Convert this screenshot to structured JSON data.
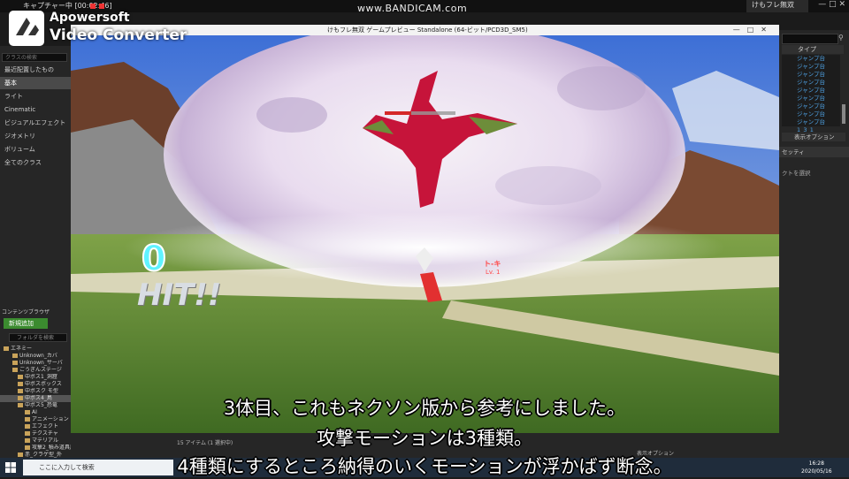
{
  "recorder": {
    "capture_label": "キャプチャー中 [00:02:46]",
    "bandicam": "www.BANDICAM.com"
  },
  "watermark": {
    "line1": "Apowersoft",
    "line2": "Video Converter"
  },
  "editor_tab": "けもフレ無双",
  "game_window": {
    "title": "けもフレ無双 ゲームプレビュー Standalone (64-ビット/PCD3D_SM5)"
  },
  "place_panel": {
    "search_placeholder": "クラスの検索",
    "items": [
      "最近配置したもの",
      "基本",
      "ライト",
      "Cinematic",
      "ビジュアルエフェクト",
      "ジオメトリ",
      "ボリューム",
      "全てのクラス"
    ]
  },
  "content_browser": {
    "header": "コンテンツブラウザ",
    "add_new": "新規追加",
    "search_placeholder": "フォルダを検索",
    "tree": [
      "エネミー",
      "Unknown_カバ",
      "Unknown_サーバ",
      "ごうぎんステージ",
      "中ボス1_洞窟",
      "中ボスボックス",
      "中ボスク モ型",
      "中ボス4_鳥",
      "中ボス5_恐竜",
      "AI",
      "アニメーション",
      "エフェクト",
      "テクスチャ",
      "マテリアル",
      "攻撃2_積み道具用",
      "赤_クラゲ型_外"
    ],
    "selected_index": 7,
    "item_count": "15 アイテム (1 選択中)"
  },
  "outliner": {
    "column_type": "タイプ",
    "items": [
      "ジャンプ台1_3_1",
      "ジャンプ台1_3_1",
      "ジャンプ台1_3_1",
      "ジャンプ台1_3_1",
      "ジャンプ台1_3_1",
      "ジャンプ台1_3_1",
      "ジャンプ台1_3_1",
      "ジャンプ台1_3_1",
      "ジャンプ台1_3_1"
    ],
    "view_options": "表示オプション",
    "details_tab": "セッティ",
    "details_hint": "クトを選択"
  },
  "bottom_view_options": "表示オプション",
  "game_hud": {
    "hit_count": "0",
    "hit_label": "HIT!!",
    "enemy_name": "ト-キ",
    "enemy_level": "Lv. 1"
  },
  "subtitles": [
    "3体目、これもネクソン版から参考にしました。",
    "攻撃モーションは3種類。",
    "4種類にするところ納得のいくモーションが浮かばず断念。"
  ],
  "taskbar": {
    "search_placeholder": "ここに入力して検索",
    "time": "16:28",
    "date": "2020/05/16"
  }
}
